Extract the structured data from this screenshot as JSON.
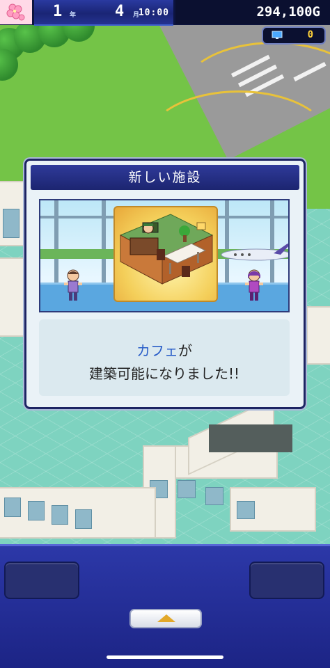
{
  "hud": {
    "season_icon": "cherry-blossom-icon",
    "month": "1",
    "month_unit": "年",
    "day": "4",
    "day_unit": "月",
    "time": "10:00",
    "money": "294,100G",
    "points_icon": "monitor-icon",
    "points": "0"
  },
  "dialog": {
    "title": "新しい施設",
    "facility_name": "カフェ",
    "line1_suffix": "が",
    "line2": "建築可能になりました!!"
  },
  "colors": {
    "hud_bg": "#0d1440",
    "dialog_title_bg": "#1c2570",
    "facility_name_text": "#2a5ec8",
    "panel_bg": "#2c38a8",
    "points_text": "#ffd23a"
  },
  "bottom_panel": {
    "left_button": "",
    "right_button": "",
    "expand_icon": "triangle-up-icon"
  }
}
